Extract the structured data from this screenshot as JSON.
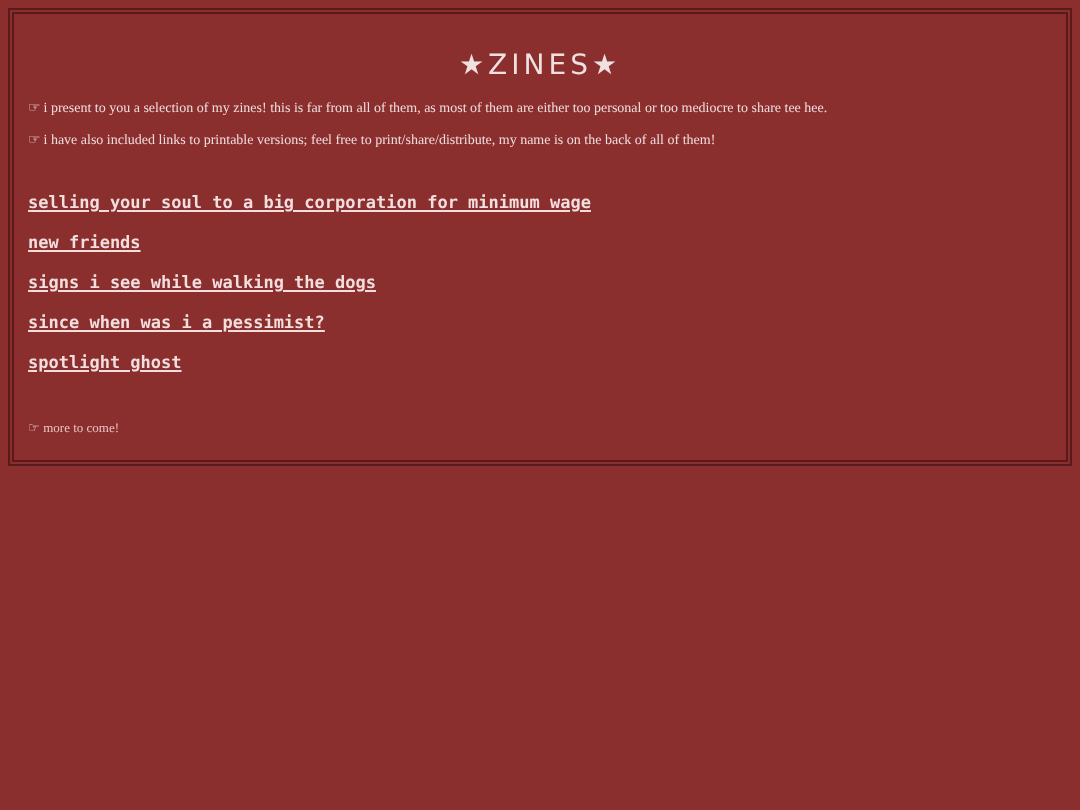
{
  "title": "★ZINES★",
  "intro": [
    "☞ i present to you a selection of my zines! this is far from all of them, as most of them are either too personal or too mediocre to share tee hee.",
    "☞ i have also included links to printable versions; feel free to print/share/distribute, my name is on the back of all of them!"
  ],
  "zines": [
    "selling your soul to a big corporation for minimum wage",
    "new friends",
    "signs i see while walking the dogs",
    "since when was i a pessimist?",
    "spotlight ghost"
  ],
  "footer": "☞ more to come!"
}
